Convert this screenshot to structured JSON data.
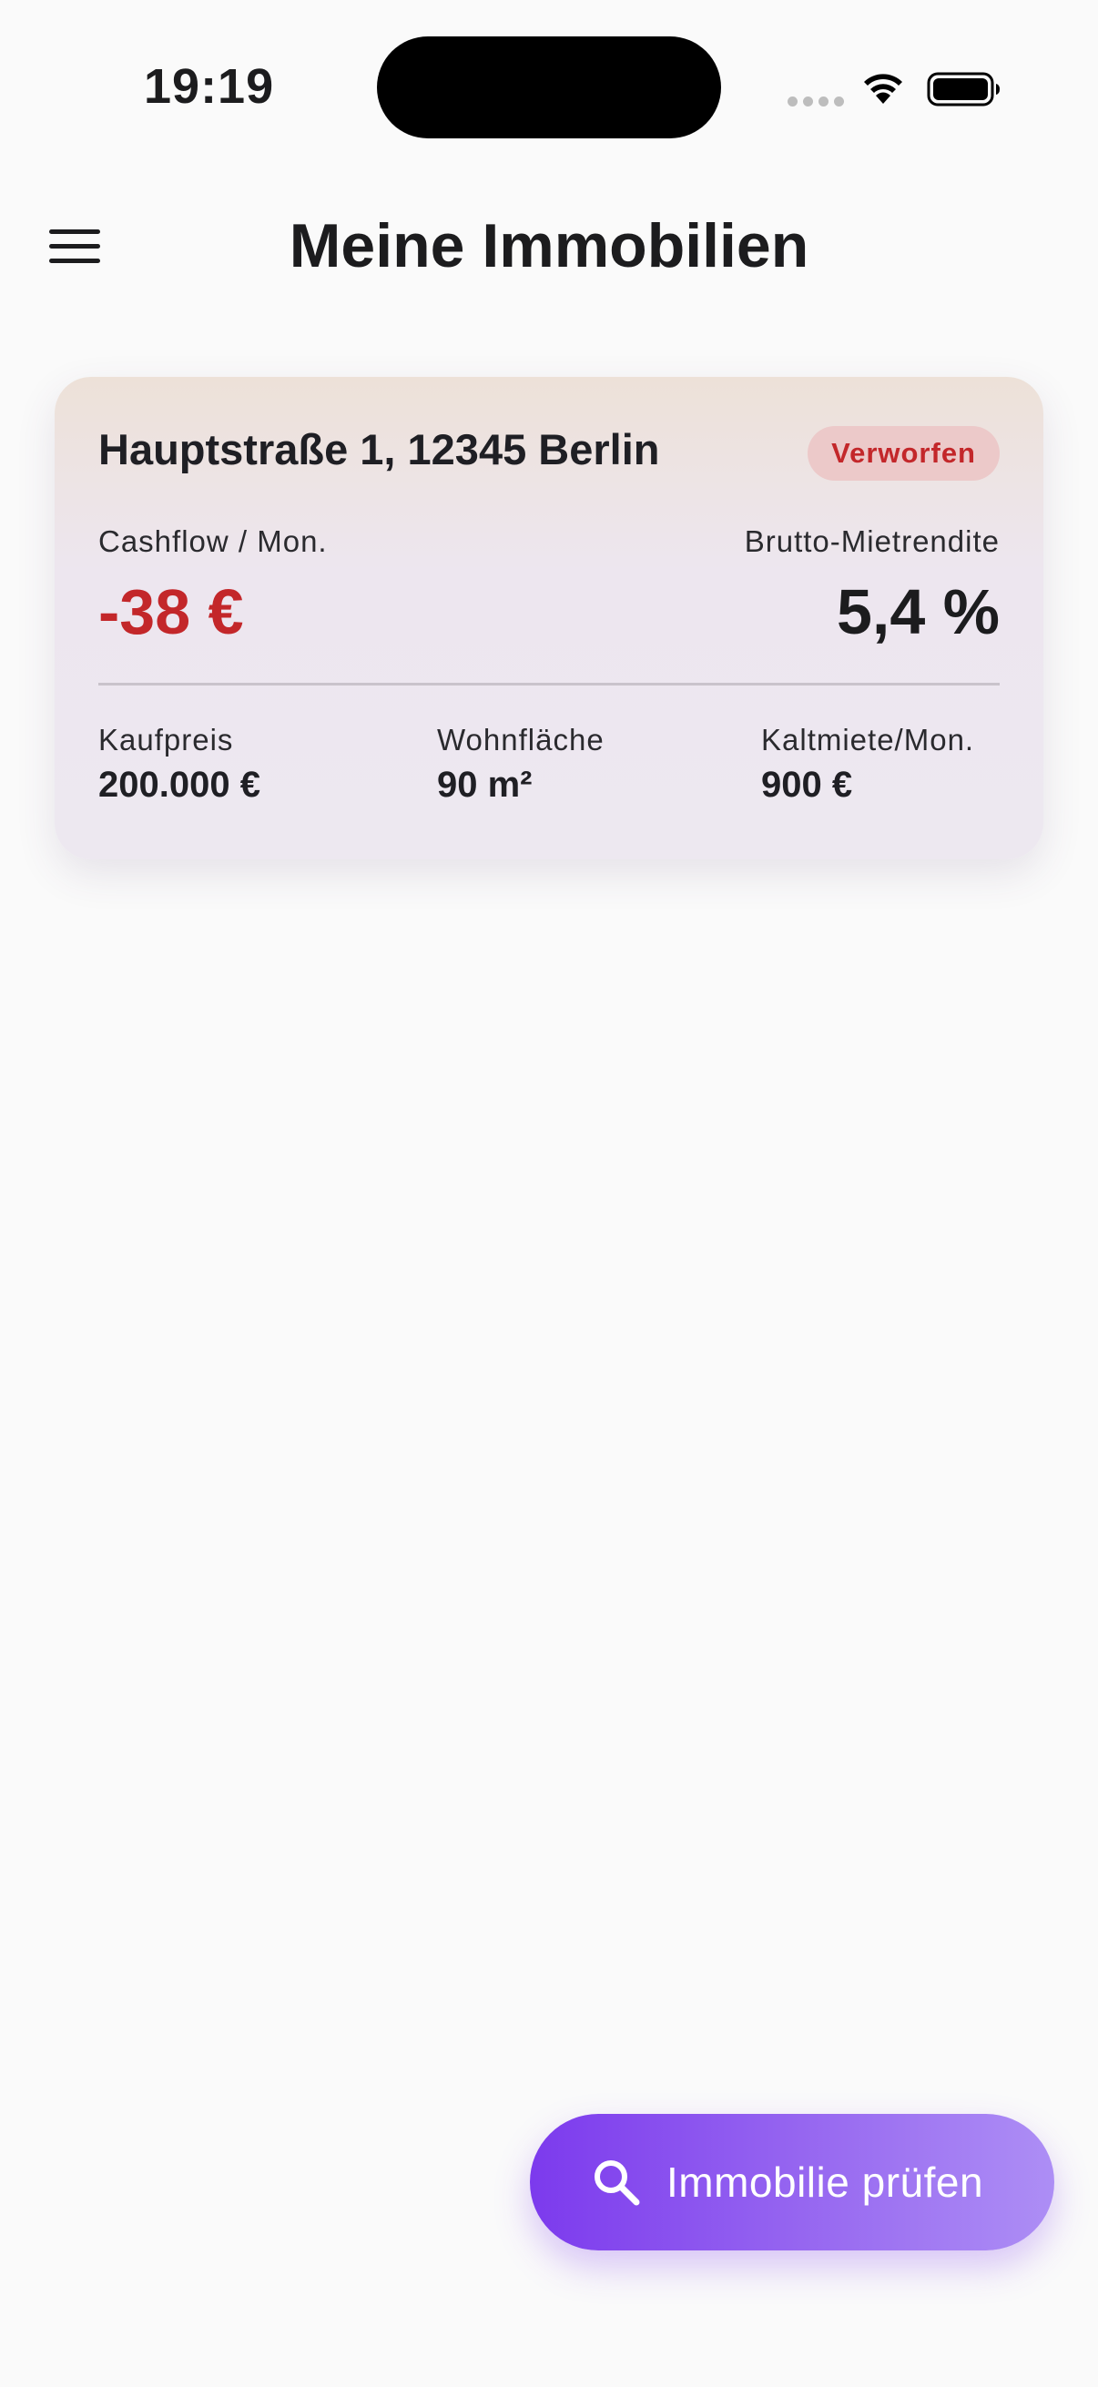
{
  "status_bar": {
    "time": "19:19"
  },
  "header": {
    "title": "Meine Immobilien"
  },
  "properties": [
    {
      "address": "Hauptstraße 1, 12345 Berlin",
      "status": "Verworfen",
      "cashflow_label": "Cashflow / Mon.",
      "cashflow_value": "-38 €",
      "yield_label": "Brutto-Mietrendite",
      "yield_value": "5,4 %",
      "price_label": "Kaufpreis",
      "price_value": "200.000 €",
      "area_label": "Wohnfläche",
      "area_value": "90 m²",
      "rent_label": "Kaltmiete/Mon.",
      "rent_value": "900 €"
    }
  ],
  "fab": {
    "label": "Immobilie prüfen",
    "icon": "search-icon"
  },
  "colors": {
    "background": "#fafafa",
    "negative": "#c3272a",
    "badge_bg": "#ecc9c9",
    "accent": "#7c3aed"
  }
}
